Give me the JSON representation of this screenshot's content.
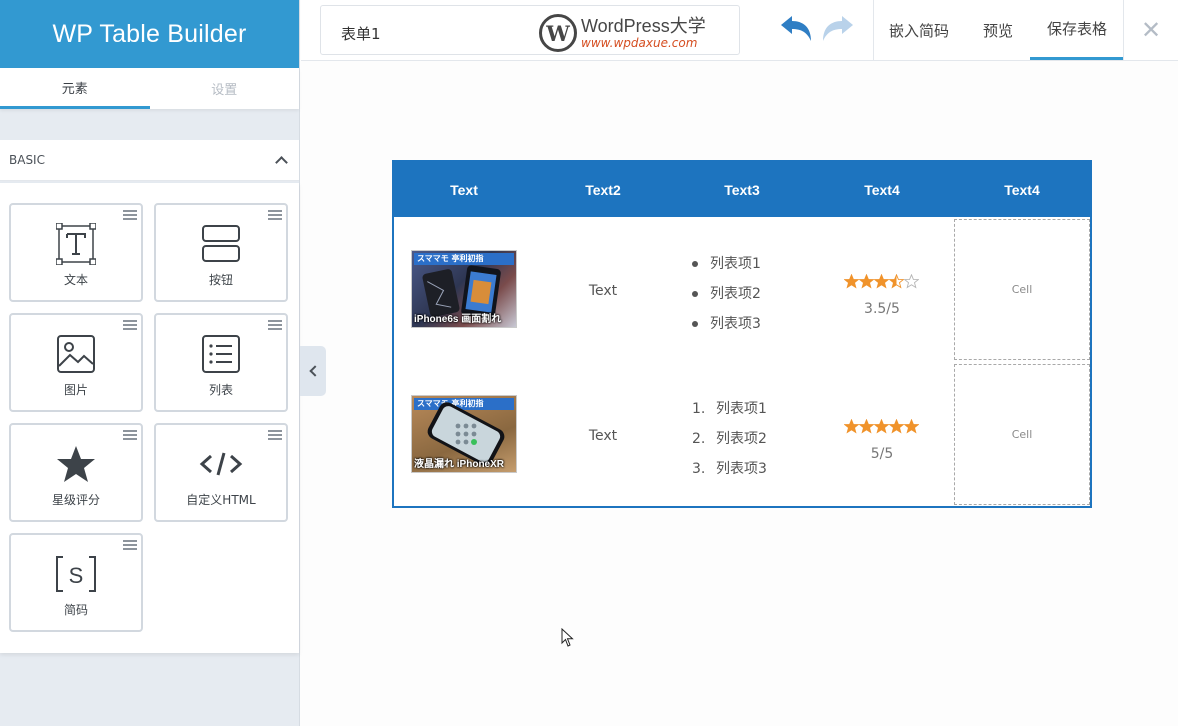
{
  "app": {
    "brand": "WP Table Builder"
  },
  "sidebar": {
    "tabs": [
      {
        "label": "元素"
      },
      {
        "label": "设置"
      }
    ],
    "section_label": "BASIC",
    "elements": [
      {
        "label": "文本",
        "icon": "text-icon"
      },
      {
        "label": "按钮",
        "icon": "button-icon"
      },
      {
        "label": "图片",
        "icon": "image-icon"
      },
      {
        "label": "列表",
        "icon": "list-icon"
      },
      {
        "label": "星级评分",
        "icon": "star-rating-icon"
      },
      {
        "label": "自定义HTML",
        "icon": "code-icon"
      },
      {
        "label": "简码",
        "icon": "shortcode-icon"
      }
    ]
  },
  "topbar": {
    "table_title": "表单1",
    "watermark": {
      "main": "WordPress大学",
      "url": "www.wpdaxue.com"
    },
    "embed_label": "嵌入简码",
    "preview_label": "预览",
    "save_label": "保存表格"
  },
  "table": {
    "headers": [
      "Text",
      "Text2",
      "Text3",
      "Text4",
      "Text4"
    ],
    "rows": [
      {
        "image_caption": "iPhone6s 画面割れ",
        "image_banner": "スママモ 亭利初指",
        "text": "Text",
        "list_type": "bullet",
        "list_items": [
          "列表项1",
          "列表项2",
          "列表项3"
        ],
        "rating": {
          "value": 3.5,
          "max": 5,
          "label": "3.5/5"
        },
        "empty_cell": "Cell"
      },
      {
        "image_caption": "液晶漏れ iPhoneXR",
        "image_banner": "スママモ 亭利初指",
        "text": "Text",
        "list_type": "numbered",
        "list_items": [
          "列表项1",
          "列表项2",
          "列表项3"
        ],
        "list_numbers": [
          "1.",
          "2.",
          "3."
        ],
        "rating": {
          "value": 5,
          "max": 5,
          "label": "5/5"
        },
        "empty_cell": "Cell"
      }
    ]
  },
  "colors": {
    "brand_blue": "#3299d1",
    "table_blue": "#1d74bf",
    "star_orange": "#f0932b"
  }
}
